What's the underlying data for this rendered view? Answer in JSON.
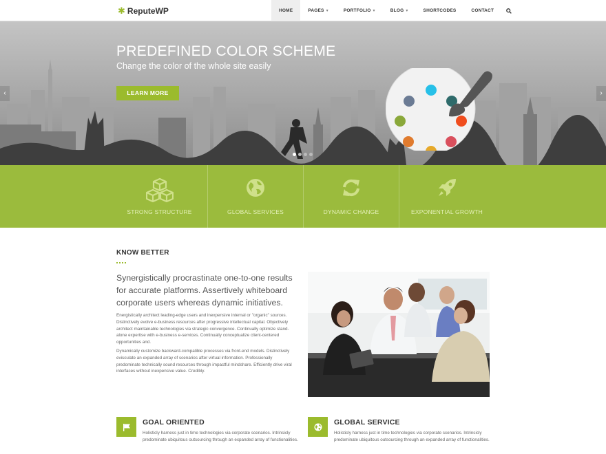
{
  "brand": {
    "logo_mark": "✱",
    "name": "ReputeWP",
    "accent": "#9bbb2d"
  },
  "nav": {
    "items": [
      {
        "label": "HOME",
        "active": true,
        "has_dropdown": false
      },
      {
        "label": "PAGES",
        "active": false,
        "has_dropdown": true
      },
      {
        "label": "PORTFOLIO",
        "active": false,
        "has_dropdown": true
      },
      {
        "label": "BLOG",
        "active": false,
        "has_dropdown": true
      },
      {
        "label": "SHORTCODES",
        "active": false,
        "has_dropdown": false
      },
      {
        "label": "CONTACT",
        "active": false,
        "has_dropdown": false
      }
    ],
    "search_icon": "search-icon"
  },
  "hero": {
    "title": "PREDEFINED COLOR SCHEME",
    "subtitle": "Change the color of the whole site easily",
    "button_label": "LEARN MORE",
    "prev_icon": "‹",
    "next_icon": "›",
    "slide_count": 4,
    "active_slide": 1,
    "palette_colors": [
      "#27c0e8",
      "#6b7b94",
      "#2f6b6b",
      "#f04d1e",
      "#8aa83a",
      "#d9505d",
      "#e07b2e",
      "#e6a92a"
    ]
  },
  "features": [
    {
      "label": "STRONG STRUCTURE",
      "icon": "cubes-icon"
    },
    {
      "label": "GLOBAL SERVICES",
      "icon": "globe-icon"
    },
    {
      "label": "DYNAMIC CHANGE",
      "icon": "refresh-icon"
    },
    {
      "label": "EXPONENTIAL GROWTH",
      "icon": "rocket-icon"
    }
  ],
  "about": {
    "title": "KNOW BETTER",
    "lead": "Synergistically procrastinate one-to-one results for accurate platforms. Assertively whiteboard corporate users whereas dynamic initiatives.",
    "paragraphs": [
      "Energistically architect leading-edge users and inexpensive internal or \"organic\" sources. Distinctively evolve e-business resources after progressive intellectual capital. Objectively architect maintainable technologies via strategic convergence. Continually optimize stand-alone expertise with e-business e-services. Continually conceptualize client-centered opportunities and.",
      "Dynamically customize backward-compatible processes via front-end models. Distinctively evisculate an expanded array of scenarios after virtual information. Professionally predominate technically sound resources through impactful mindshare. Efficiently drive viral interfaces without inexpensive value. Credibly."
    ]
  },
  "services": [
    {
      "title": "GOAL ORIENTED",
      "icon": "flag-icon",
      "text": "Holisticly harness just in time technologies via corporate scenarios. Intrinsicly predominate ubiquitous outsourcing through an expanded array of functionalities."
    },
    {
      "title": "GLOBAL SERVICE",
      "icon": "globe-icon",
      "text": "Holisticly harness just in time technologies via corporate scenarios. Intrinsicly predominate ubiquitous outsourcing through an expanded array of functionalities."
    }
  ]
}
